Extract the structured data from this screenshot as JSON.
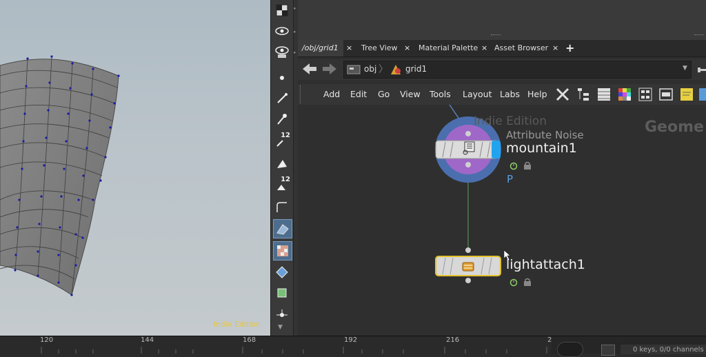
{
  "viewport": {
    "watermark": "Indie Edition"
  },
  "toolbar": {
    "num_badge_1": "12",
    "num_badge_2": "12"
  },
  "tabs": [
    {
      "label": "/obj/grid1"
    },
    {
      "label": "Tree View"
    },
    {
      "label": "Material Palette"
    },
    {
      "label": "Asset Browser"
    }
  ],
  "tab_close": "×",
  "tab_add": "+",
  "path": {
    "obj": "obj",
    "grid": "grid1"
  },
  "menu": [
    "Add",
    "Edit",
    "Go",
    "View",
    "Tools",
    "Layout",
    "Labs",
    "Help"
  ],
  "network": {
    "watermark": "Indie Edition",
    "context_label": "Geome",
    "node1": {
      "type": "Attribute Noise",
      "name": "mountain1",
      "flag": "P"
    },
    "node2": {
      "name": "lightattach1"
    }
  },
  "timeline": {
    "ticks": [
      "120",
      "144",
      "168",
      "192",
      "216",
      "2"
    ],
    "status": "0 keys, 0/0 channels"
  }
}
